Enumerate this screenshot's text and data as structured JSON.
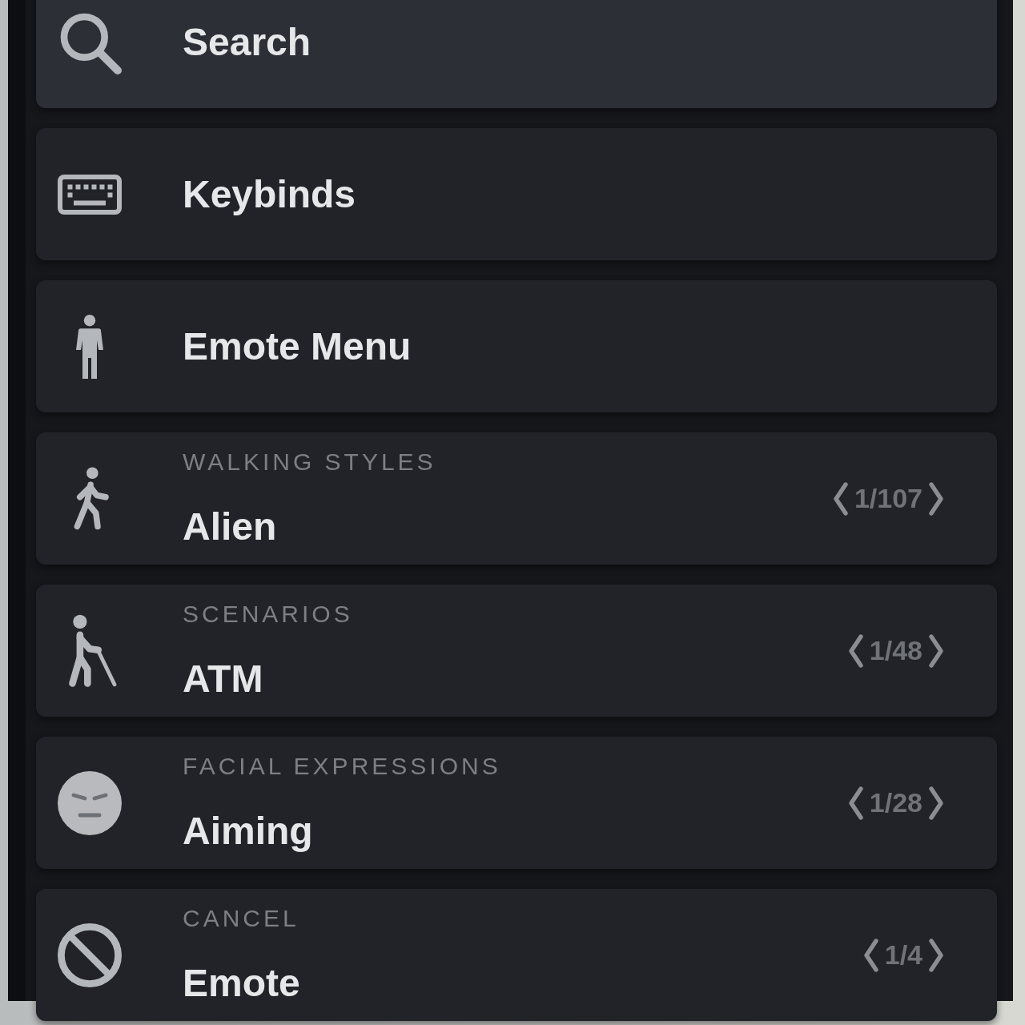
{
  "menu": {
    "items": [
      {
        "kind": "action",
        "label": "Search",
        "selected": true
      },
      {
        "kind": "action",
        "label": "Keybinds",
        "selected": false
      },
      {
        "kind": "action",
        "label": "Emote Menu",
        "selected": false
      },
      {
        "kind": "selector",
        "category": "WALKING STYLES",
        "value": "Alien",
        "counter": "1/107",
        "selected": false
      },
      {
        "kind": "selector",
        "category": "SCENARIOS",
        "value": "ATM",
        "counter": "1/48",
        "selected": false
      },
      {
        "kind": "selector",
        "category": "FACIAL EXPRESSIONS",
        "value": "Aiming",
        "counter": "1/28",
        "selected": false
      },
      {
        "kind": "selector",
        "category": "CANCEL",
        "value": "Emote",
        "counter": "1/4",
        "selected": false
      }
    ]
  }
}
